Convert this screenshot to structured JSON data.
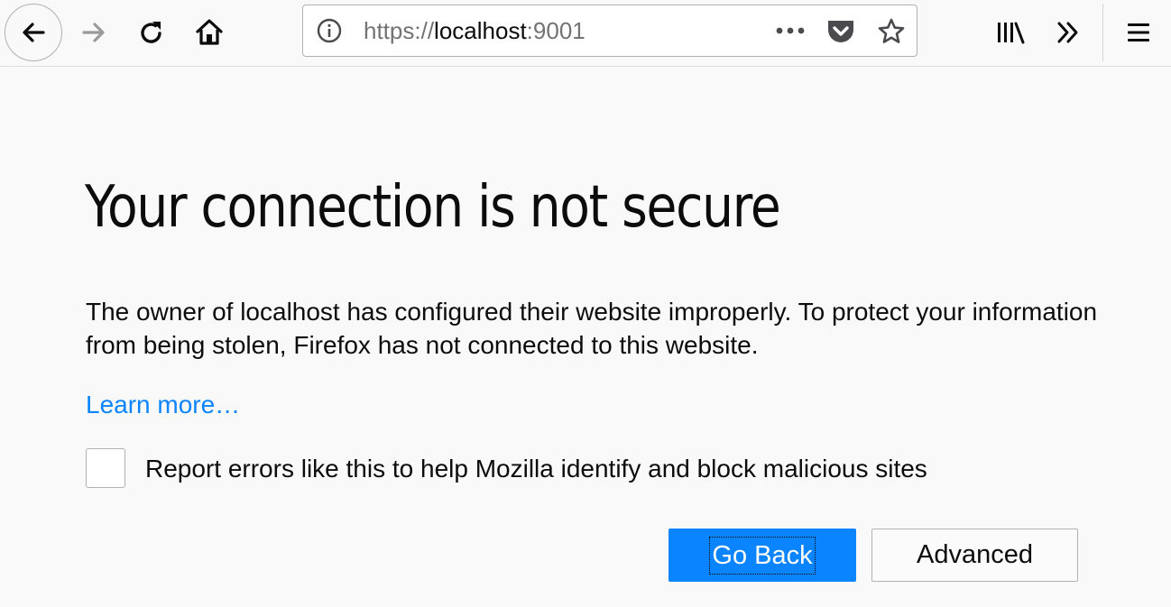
{
  "browser": {
    "url": {
      "scheme": "https://",
      "host": "localhost",
      "port": ":9001"
    },
    "icons": {
      "back": "back-arrow-icon",
      "forward": "forward-arrow-icon",
      "reload": "reload-icon",
      "home": "home-icon",
      "info": "info-icon",
      "more": "more-dots-icon",
      "pocket": "pocket-icon",
      "bookmark": "star-icon",
      "library": "library-icon",
      "overflow": "double-chevron-icon",
      "menu": "hamburger-menu-icon"
    }
  },
  "error_page": {
    "title": "Your connection is not secure",
    "description": "The owner of localhost has configured their website improperly. To protect your information from being stolen, Firefox has not connected to this website.",
    "learn_more": "Learn more…",
    "report_checkbox_label": "Report errors like this to help Mozilla identify and block malicious sites",
    "report_checked": false,
    "go_back_label": "Go Back",
    "advanced_label": "Advanced"
  },
  "colors": {
    "accent": "#0a84ff",
    "background": "#f9f9fa",
    "text": "#0c0c0d"
  }
}
